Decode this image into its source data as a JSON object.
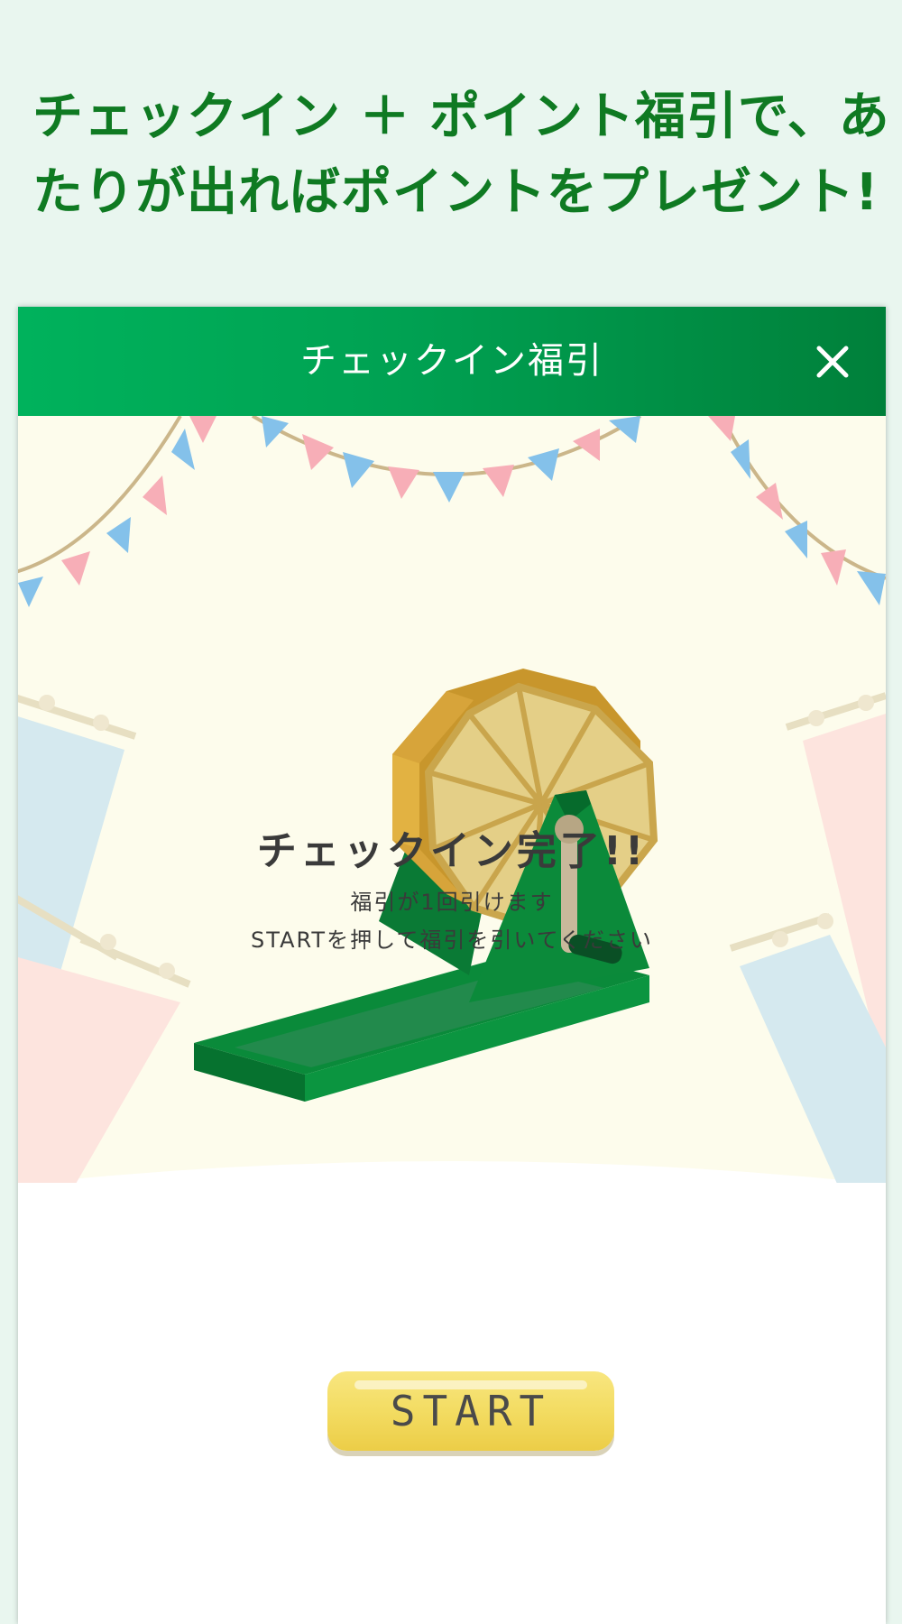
{
  "headline": {
    "line1": "チェックイン ＋ ポイント福引で、あ",
    "line2": "たりが出ればポイントをプレゼント!"
  },
  "modal": {
    "title": "チェックイン福引",
    "close_icon": "close-icon",
    "done_title": "チェックイン完了!!",
    "subtitle_line1": "福引が1回引けます",
    "subtitle_line2": "STARTを押して福引を引いてください",
    "start_label": "START"
  },
  "colors": {
    "page_bg": "#e9f6ef",
    "headline": "#0f7a22",
    "header_start": "#00b25c",
    "header_end": "#00803a",
    "stage_bg": "#fdfcec",
    "button": "#f3dc62",
    "drum": "#e3c06a",
    "machine": "#0a8a3a"
  }
}
